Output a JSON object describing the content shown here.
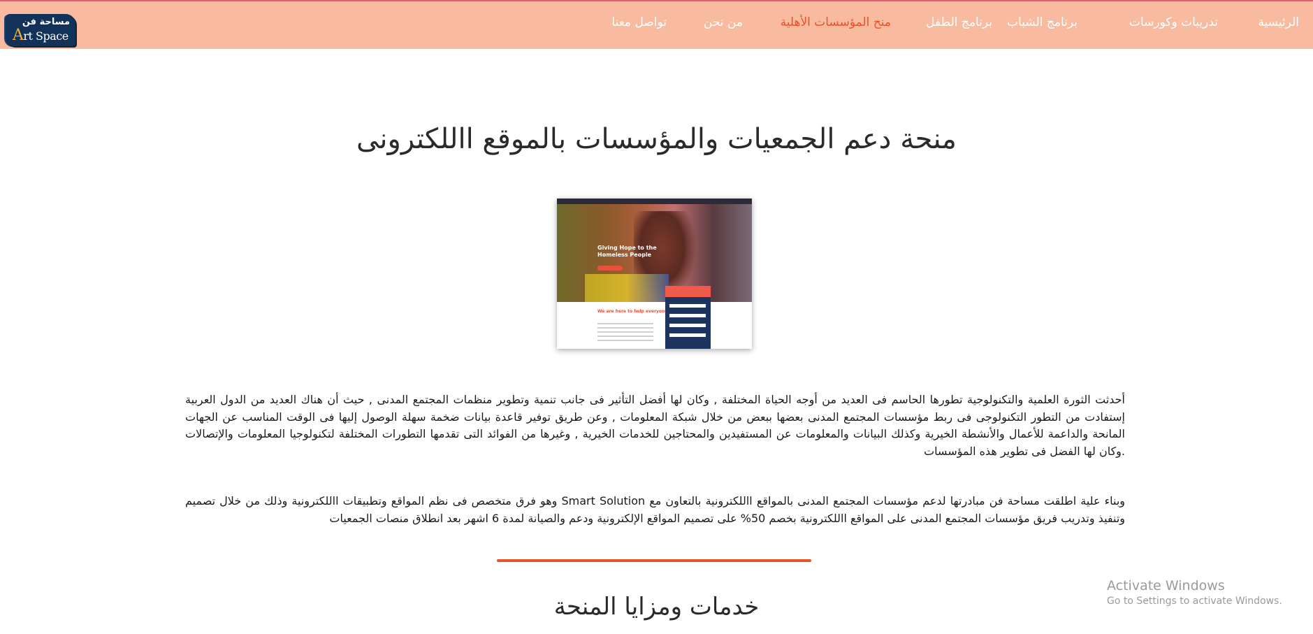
{
  "header": {
    "logo": {
      "arabic_text": "مساحة فن",
      "english_text": "Art Space"
    },
    "nav": [
      {
        "label": "الرئيسية",
        "active": false
      },
      {
        "label": "تدريبات وكورسات",
        "active": false
      },
      {
        "label": "برنامج الشباب",
        "active": false
      },
      {
        "label": "برنامج الطفل",
        "active": false
      },
      {
        "label": "منح المؤسسات الأهلية",
        "active": true
      },
      {
        "label": "من نحن",
        "active": false
      },
      {
        "label": "تواصل معنا",
        "active": false
      }
    ],
    "colors": {
      "bar": "#f8bba0",
      "active_link": "#e8522a",
      "link": "#ffffff"
    }
  },
  "main": {
    "title": "منحة دعم الجمعيات والمؤسسات بالموقع االلكترونى",
    "preview_image": {
      "hero_title": "Giving Hope to the Homeless People",
      "section_title": "We are here to help everyone in need"
    },
    "paragraph1": "أحدثت الثورة العلمية والتكنولوجية تطورها الحاسم فى العديد من أوجه الحياة المختلفة , وكان لها أفضل التأثير فى جانب تنمية وتطوير منظمات المجتمع المدنى , حيث أن هناك العديد من الدول العربية إستفادت من التطور التكنولوجى فى ربط مؤسسات المجتمع المدنى بعضها ببعض من خلال شبكة المعلومات , وعن طريق توفير قاعدة بيانات ضخمة سهلة الوصول إليها فى الوقت المناسب عن الجهات المانحة والداعمة للأعمال والأنشطة الخيرية وكذلك البيانات والمعلومات عن المستفيدين والمحتاجين للخدمات الخيرية , وغيرها من الفوائد التى تقدمها التطورات المختلفة لتكنولوجيا المعلومات والإتصالات .وكان لها الفضل فى تطوير هذه المؤسسات",
    "paragraph2": "وبناء علية اطلقت مساحة فن مبادرتها لدعم مؤسسات المجتمع المدنى بالمواقع االلكترونية بالتعاون مع Smart Solution وهو فرق متخصص فى نظم المواقع وتطبيقات االلكترونية وذلك من خلال تصميم وتنفيذ وتدريب فريق مؤسسات المجتمع المدنى على المواقع االلكترونية بخصم 50% على تصميم المواقع الإلكترونية ودعم والصيانة لمدة 6 اشهر بعد انطلاق منصات الجمعيات",
    "divider_color": "#e8552a",
    "section_title": "خدمات ومزايا المنحة"
  },
  "watermark": {
    "line1": "Activate Windows",
    "line2": "Go to Settings to activate Windows."
  }
}
